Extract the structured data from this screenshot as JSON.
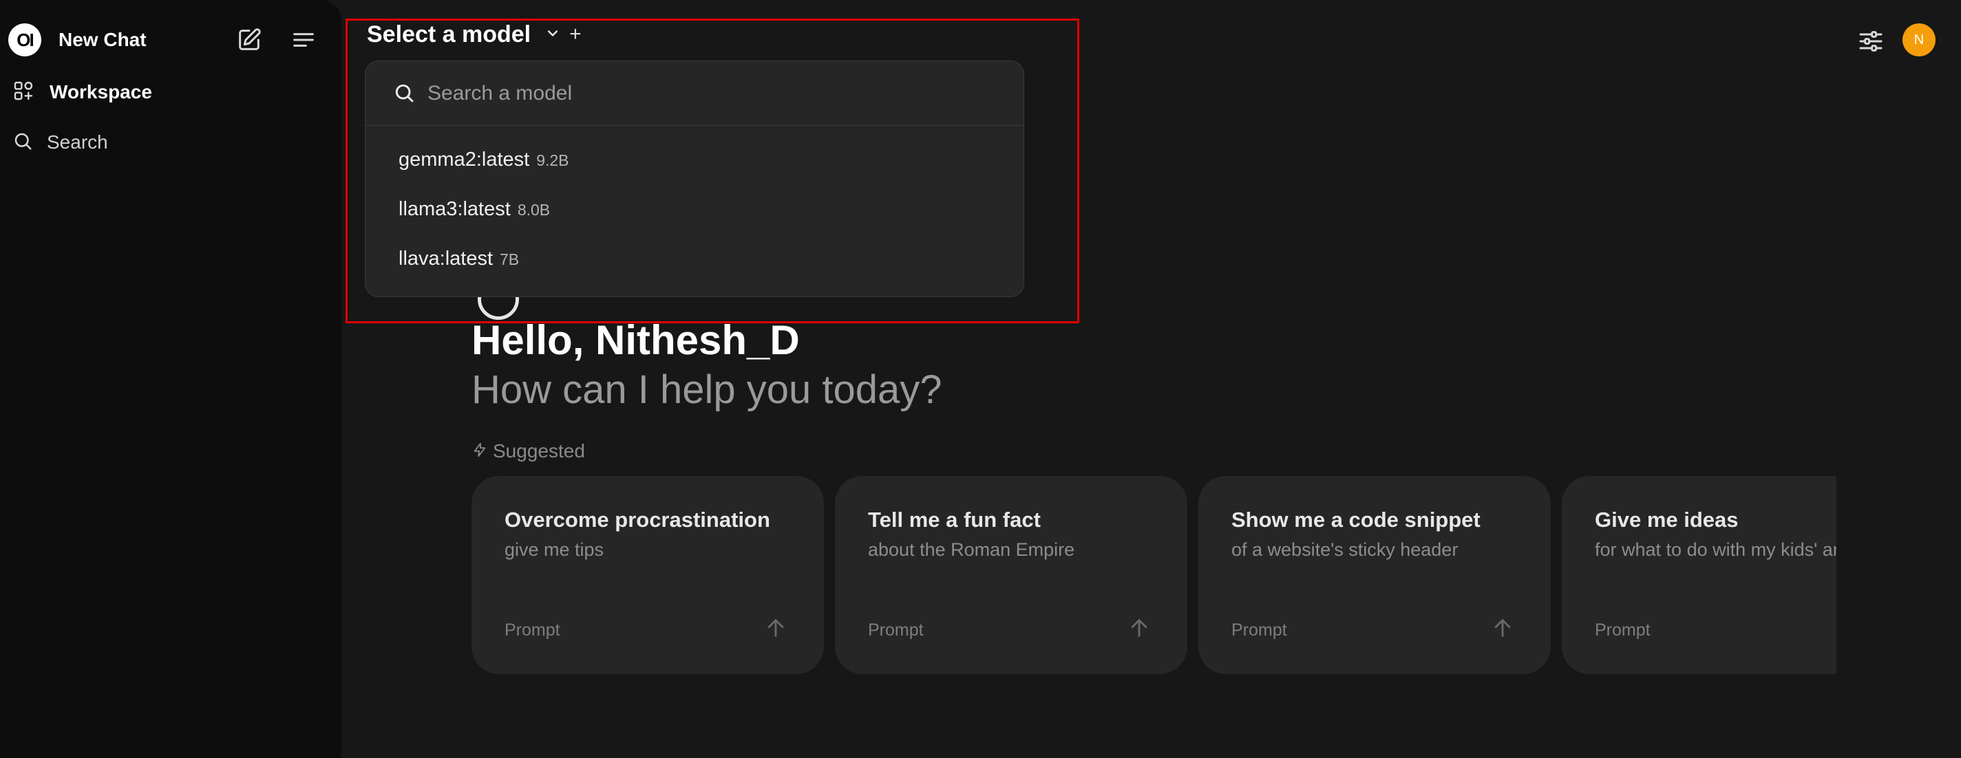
{
  "sidebar": {
    "logo_text": "OI",
    "title": "New Chat",
    "workspace_label": "Workspace",
    "search_label": "Search"
  },
  "header": {
    "model_selector_label": "Select a model",
    "add_model_symbol": "+",
    "avatar_initial": "N"
  },
  "model_dropdown": {
    "search_placeholder": "Search a model",
    "models": [
      {
        "name": "gemma2:latest",
        "size": "9.2B"
      },
      {
        "name": "llama3:latest",
        "size": "8.0B"
      },
      {
        "name": "llava:latest",
        "size": "7B"
      }
    ]
  },
  "main": {
    "greeting": "Hello, Nithesh_D",
    "subtitle": "How can I help you today?",
    "suggested_label": "Suggested",
    "cards": [
      {
        "title": "Overcome procrastination",
        "subtitle": "give me tips",
        "prompt_label": "Prompt"
      },
      {
        "title": "Tell me a fun fact",
        "subtitle": "about the Roman Empire",
        "prompt_label": "Prompt"
      },
      {
        "title": "Show me a code snippet",
        "subtitle": "of a website's sticky header",
        "prompt_label": "Prompt"
      },
      {
        "title": "Give me ideas",
        "subtitle": "for what to do with my kids' art",
        "prompt_label": "Prompt"
      }
    ]
  },
  "colors": {
    "background": "#171717",
    "sidebar": "#0d0d0d",
    "card": "#262626",
    "avatar": "#f59e0b",
    "highlight": "#e00000"
  }
}
